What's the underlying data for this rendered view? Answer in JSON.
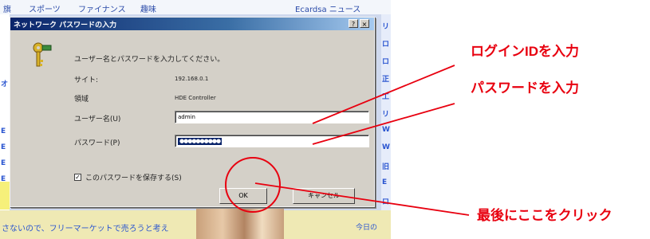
{
  "browser": {
    "menu": [
      "旗",
      "スポーツ",
      "ファイナンス",
      "趣味"
    ],
    "right_text": "Ecardsa  ニュース",
    "left_edge": [
      "オ",
      "E",
      "E",
      "E",
      "E"
    ],
    "right_edge": [
      "リ",
      "ロ",
      "ロ",
      "正",
      "工",
      "リ",
      "W",
      "W",
      "旧",
      "E",
      "ロ"
    ],
    "bottom_text": "さないので、フリーマーケットで売ろうと考え",
    "bottom_right": "今日の"
  },
  "dialog": {
    "title": "ネットワーク パスワードの入力",
    "help_label": "?",
    "close_label": "×",
    "message": "ユーザー名とパスワードを入力してください。",
    "site_label": "サイト:",
    "site_value": "192.168.0.1",
    "realm_label": "領域",
    "realm_value": "HDE Controller",
    "username_label": "ユーザー名(U)",
    "username_value": "admin",
    "password_label": "パスワード(P)",
    "password_value": "●●●●●●●●●●",
    "save_label": "このパスワードを保存する(S)",
    "save_checked": "✓",
    "ok_label": "OK",
    "cancel_label": "キャンセル"
  },
  "annotations": {
    "login_id": "ログインIDを入力",
    "password": "パスワードを入力",
    "click_here": "最後にここをクリック",
    "color": "#e8000f"
  }
}
